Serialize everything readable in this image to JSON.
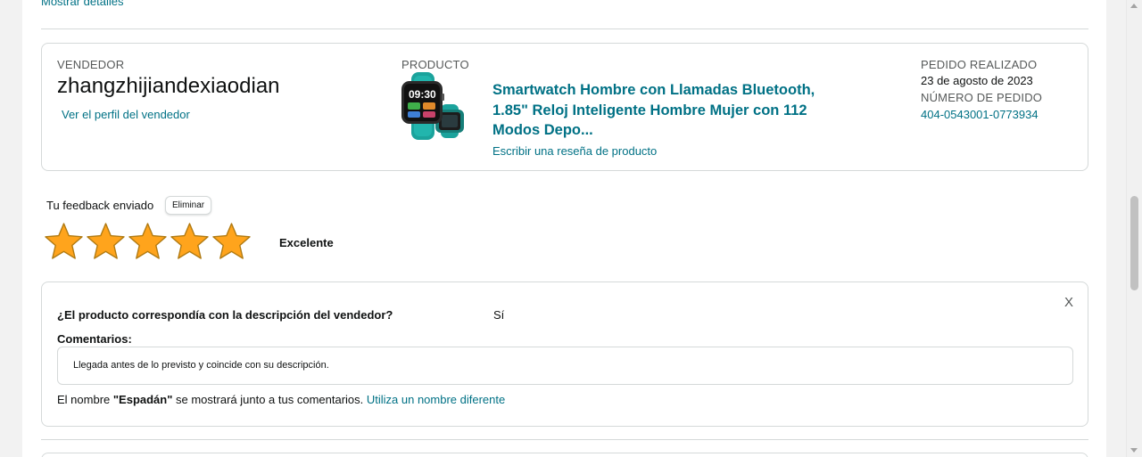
{
  "top": {
    "show_details": "Mostrar detalles"
  },
  "order": {
    "seller_label": "VENDEDOR",
    "seller_name": "zhangzhijiandexiaodian",
    "seller_profile_link": "Ver el perfil del vendedor",
    "product_label": "PRODUCTO",
    "product_title": "Smartwatch Hombre con Llamadas Bluetooth, 1.85\" Reloj Inteligente Hombre Mujer con 112 Modos Depo...",
    "product_image_time": "09:30",
    "review_link": "Escribir una reseña de producto",
    "order_placed_label": "PEDIDO REALIZADO",
    "order_date": "23 de agosto de 2023",
    "order_number_label": "NÚMERO DE PEDIDO",
    "order_number": "404-0543001-0773934"
  },
  "feedback": {
    "sent_label": "Tu feedback enviado",
    "delete_button": "Eliminar",
    "rating": 5,
    "rating_max": 5,
    "rating_text": "Excelente",
    "star_color": "#ffa41c"
  },
  "question": {
    "close": "X",
    "text": "¿El producto correspondía con la descripción del vendedor?",
    "answer": "Sí",
    "comments_label": "Comentarios:",
    "comment": "Llegada antes de lo previsto y coincide con su descripción.",
    "name_prefix": "El nombre ",
    "name": "\"Espadán\"",
    "name_suffix": " se mostrará junto a tus comentarios. ",
    "change_name_link": "Utiliza un nombre diferente"
  },
  "colors": {
    "link": "#007185",
    "border": "#d5d9d9",
    "watch_teal": "#1ba39c"
  }
}
